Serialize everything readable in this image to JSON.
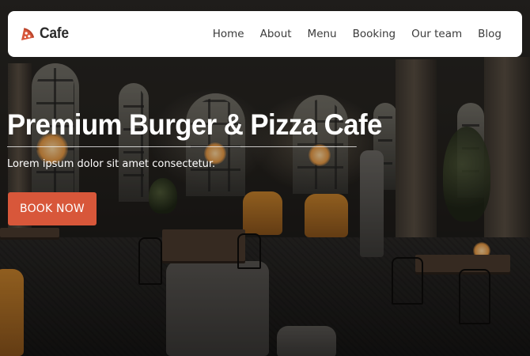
{
  "brand": {
    "name": "Cafe",
    "logo_icon": "pizza-slice-icon",
    "accent_color": "#d8573a"
  },
  "nav": {
    "items": [
      {
        "label": "Home"
      },
      {
        "label": "About"
      },
      {
        "label": "Menu"
      },
      {
        "label": "Booking"
      },
      {
        "label": "Our team"
      },
      {
        "label": "Blog"
      }
    ]
  },
  "hero": {
    "title": "Premium Burger & Pizza Cafe",
    "subtitle": "Lorem ipsum dolor sit amet consectetur.",
    "cta_label": "BOOK NOW"
  }
}
